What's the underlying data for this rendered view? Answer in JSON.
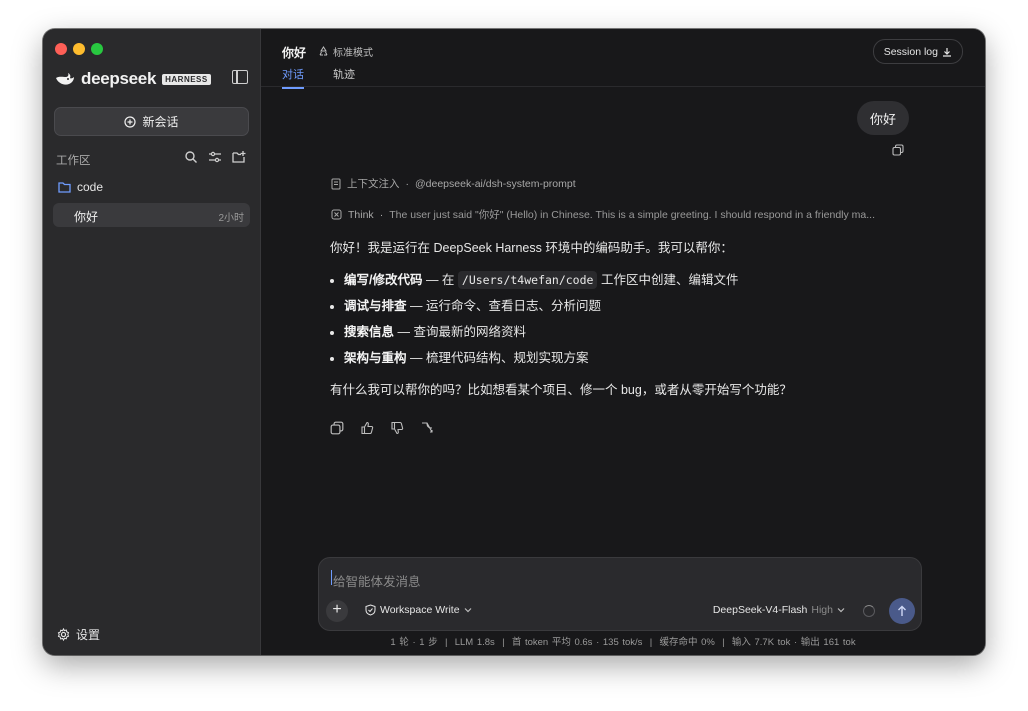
{
  "sidebar": {
    "brand": "deepseek",
    "brand_badge": "HARNESS",
    "new_chat_label": "新会话",
    "workspace_label": "工作区",
    "folder_name": "code",
    "sessions": [
      {
        "title": "你好",
        "time": "2小时"
      }
    ],
    "settings_label": "设置"
  },
  "header": {
    "title": "你好",
    "mode": "标准模式",
    "tabs": [
      {
        "label": "对话",
        "active": true
      },
      {
        "label": "轨迹",
        "active": false
      }
    ],
    "session_log_label": "Session log"
  },
  "conversation": {
    "user_message": "你好",
    "context_label": "上下文注入",
    "context_value": "@deepseek-ai/dsh-system-prompt",
    "think_label": "Think",
    "think_text": "The user just said \"你好\" (Hello) in Chinese. This is a simple greeting. I should respond in a friendly ma...",
    "answer_intro": "你好！我是运行在 DeepSeek Harness 环境中的编码助手。我可以帮你：",
    "bullets": [
      {
        "bold": "编写/修改代码",
        "pre": " — 在 ",
        "code": "/Users/t4wefan/code",
        "post": " 工作区中创建、编辑文件"
      },
      {
        "bold": "调试与排查",
        "pre": " — 运行命令、查看日志、分析问题",
        "code": "",
        "post": ""
      },
      {
        "bold": "搜索信息",
        "pre": " — 查询最新的网络资料",
        "code": "",
        "post": ""
      },
      {
        "bold": "架构与重构",
        "pre": " — 梳理代码结构、规划实现方案",
        "code": "",
        "post": ""
      }
    ],
    "answer_outro": "有什么我可以帮你的吗？比如想看某个项目、修一个 bug，或者从零开始写个功能？"
  },
  "composer": {
    "placeholder": "给智能体发消息",
    "workspace_mode": "Workspace Write",
    "model": "DeepSeek-V4-Flash",
    "model_level": "High"
  },
  "status_bar": "1 轮 · 1 步  |  LLM 1.8s  |  首 token 平均 0.6s · 135 tok/s  |  缓存命中 0%  |  输入 7.7K tok · 输出 161 tok",
  "colors": {
    "accent": "#6f9cff",
    "sidebar_bg": "#2a2a2c",
    "main_bg": "#18181a"
  }
}
